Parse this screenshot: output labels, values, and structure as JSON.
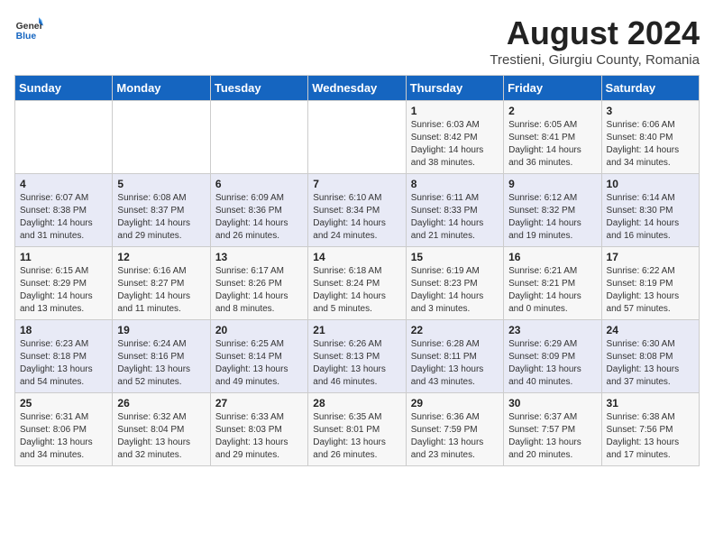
{
  "logo": {
    "general": "General",
    "blue": "Blue"
  },
  "title": "August 2024",
  "subtitle": "Trestieni, Giurgiu County, Romania",
  "days_of_week": [
    "Sunday",
    "Monday",
    "Tuesday",
    "Wednesday",
    "Thursday",
    "Friday",
    "Saturday"
  ],
  "weeks": [
    [
      {
        "day": "",
        "info": ""
      },
      {
        "day": "",
        "info": ""
      },
      {
        "day": "",
        "info": ""
      },
      {
        "day": "",
        "info": ""
      },
      {
        "day": "1",
        "info": "Sunrise: 6:03 AM\nSunset: 8:42 PM\nDaylight: 14 hours and 38 minutes."
      },
      {
        "day": "2",
        "info": "Sunrise: 6:05 AM\nSunset: 8:41 PM\nDaylight: 14 hours and 36 minutes."
      },
      {
        "day": "3",
        "info": "Sunrise: 6:06 AM\nSunset: 8:40 PM\nDaylight: 14 hours and 34 minutes."
      }
    ],
    [
      {
        "day": "4",
        "info": "Sunrise: 6:07 AM\nSunset: 8:38 PM\nDaylight: 14 hours and 31 minutes."
      },
      {
        "day": "5",
        "info": "Sunrise: 6:08 AM\nSunset: 8:37 PM\nDaylight: 14 hours and 29 minutes."
      },
      {
        "day": "6",
        "info": "Sunrise: 6:09 AM\nSunset: 8:36 PM\nDaylight: 14 hours and 26 minutes."
      },
      {
        "day": "7",
        "info": "Sunrise: 6:10 AM\nSunset: 8:34 PM\nDaylight: 14 hours and 24 minutes."
      },
      {
        "day": "8",
        "info": "Sunrise: 6:11 AM\nSunset: 8:33 PM\nDaylight: 14 hours and 21 minutes."
      },
      {
        "day": "9",
        "info": "Sunrise: 6:12 AM\nSunset: 8:32 PM\nDaylight: 14 hours and 19 minutes."
      },
      {
        "day": "10",
        "info": "Sunrise: 6:14 AM\nSunset: 8:30 PM\nDaylight: 14 hours and 16 minutes."
      }
    ],
    [
      {
        "day": "11",
        "info": "Sunrise: 6:15 AM\nSunset: 8:29 PM\nDaylight: 14 hours and 13 minutes."
      },
      {
        "day": "12",
        "info": "Sunrise: 6:16 AM\nSunset: 8:27 PM\nDaylight: 14 hours and 11 minutes."
      },
      {
        "day": "13",
        "info": "Sunrise: 6:17 AM\nSunset: 8:26 PM\nDaylight: 14 hours and 8 minutes."
      },
      {
        "day": "14",
        "info": "Sunrise: 6:18 AM\nSunset: 8:24 PM\nDaylight: 14 hours and 5 minutes."
      },
      {
        "day": "15",
        "info": "Sunrise: 6:19 AM\nSunset: 8:23 PM\nDaylight: 14 hours and 3 minutes."
      },
      {
        "day": "16",
        "info": "Sunrise: 6:21 AM\nSunset: 8:21 PM\nDaylight: 14 hours and 0 minutes."
      },
      {
        "day": "17",
        "info": "Sunrise: 6:22 AM\nSunset: 8:19 PM\nDaylight: 13 hours and 57 minutes."
      }
    ],
    [
      {
        "day": "18",
        "info": "Sunrise: 6:23 AM\nSunset: 8:18 PM\nDaylight: 13 hours and 54 minutes."
      },
      {
        "day": "19",
        "info": "Sunrise: 6:24 AM\nSunset: 8:16 PM\nDaylight: 13 hours and 52 minutes."
      },
      {
        "day": "20",
        "info": "Sunrise: 6:25 AM\nSunset: 8:14 PM\nDaylight: 13 hours and 49 minutes."
      },
      {
        "day": "21",
        "info": "Sunrise: 6:26 AM\nSunset: 8:13 PM\nDaylight: 13 hours and 46 minutes."
      },
      {
        "day": "22",
        "info": "Sunrise: 6:28 AM\nSunset: 8:11 PM\nDaylight: 13 hours and 43 minutes."
      },
      {
        "day": "23",
        "info": "Sunrise: 6:29 AM\nSunset: 8:09 PM\nDaylight: 13 hours and 40 minutes."
      },
      {
        "day": "24",
        "info": "Sunrise: 6:30 AM\nSunset: 8:08 PM\nDaylight: 13 hours and 37 minutes."
      }
    ],
    [
      {
        "day": "25",
        "info": "Sunrise: 6:31 AM\nSunset: 8:06 PM\nDaylight: 13 hours and 34 minutes."
      },
      {
        "day": "26",
        "info": "Sunrise: 6:32 AM\nSunset: 8:04 PM\nDaylight: 13 hours and 32 minutes."
      },
      {
        "day": "27",
        "info": "Sunrise: 6:33 AM\nSunset: 8:03 PM\nDaylight: 13 hours and 29 minutes."
      },
      {
        "day": "28",
        "info": "Sunrise: 6:35 AM\nSunset: 8:01 PM\nDaylight: 13 hours and 26 minutes."
      },
      {
        "day": "29",
        "info": "Sunrise: 6:36 AM\nSunset: 7:59 PM\nDaylight: 13 hours and 23 minutes."
      },
      {
        "day": "30",
        "info": "Sunrise: 6:37 AM\nSunset: 7:57 PM\nDaylight: 13 hours and 20 minutes."
      },
      {
        "day": "31",
        "info": "Sunrise: 6:38 AM\nSunset: 7:56 PM\nDaylight: 13 hours and 17 minutes."
      }
    ]
  ]
}
